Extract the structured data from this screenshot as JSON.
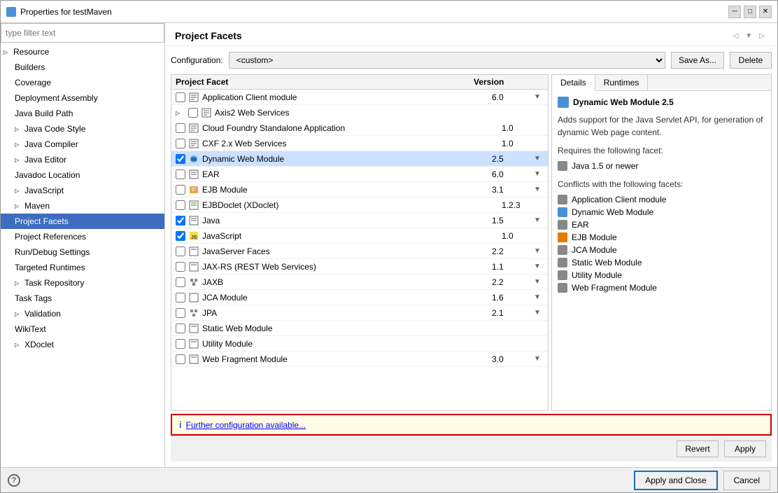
{
  "window": {
    "title": "Properties for testMaven"
  },
  "filter": {
    "placeholder": "type filter text"
  },
  "sidebar": {
    "items": [
      {
        "id": "resource",
        "label": "Resource",
        "expandable": true,
        "indent": 0
      },
      {
        "id": "builders",
        "label": "Builders",
        "expandable": false,
        "indent": 1
      },
      {
        "id": "coverage",
        "label": "Coverage",
        "expandable": false,
        "indent": 1
      },
      {
        "id": "deployment-assembly",
        "label": "Deployment Assembly",
        "expandable": false,
        "indent": 1
      },
      {
        "id": "java-build-path",
        "label": "Java Build Path",
        "expandable": false,
        "indent": 1
      },
      {
        "id": "java-code-style",
        "label": "Java Code Style",
        "expandable": true,
        "indent": 1
      },
      {
        "id": "java-compiler",
        "label": "Java Compiler",
        "expandable": true,
        "indent": 1
      },
      {
        "id": "java-editor",
        "label": "Java Editor",
        "expandable": true,
        "indent": 1
      },
      {
        "id": "javadoc-location",
        "label": "Javadoc Location",
        "expandable": false,
        "indent": 1
      },
      {
        "id": "javascript",
        "label": "JavaScript",
        "expandable": true,
        "indent": 1
      },
      {
        "id": "maven",
        "label": "Maven",
        "expandable": true,
        "indent": 1
      },
      {
        "id": "project-facets",
        "label": "Project Facets",
        "expandable": false,
        "indent": 1,
        "selected": true
      },
      {
        "id": "project-references",
        "label": "Project References",
        "expandable": false,
        "indent": 1
      },
      {
        "id": "run-debug-settings",
        "label": "Run/Debug Settings",
        "expandable": false,
        "indent": 1
      },
      {
        "id": "targeted-runtimes",
        "label": "Targeted Runtimes",
        "expandable": false,
        "indent": 1
      },
      {
        "id": "task-repository",
        "label": "Task Repository",
        "expandable": true,
        "indent": 1
      },
      {
        "id": "task-tags",
        "label": "Task Tags",
        "expandable": false,
        "indent": 1
      },
      {
        "id": "validation",
        "label": "Validation",
        "expandable": true,
        "indent": 1
      },
      {
        "id": "wikitext",
        "label": "WikiText",
        "expandable": false,
        "indent": 1
      },
      {
        "id": "xdoclet",
        "label": "XDoclet",
        "expandable": true,
        "indent": 1
      }
    ]
  },
  "page": {
    "title": "Project Facets",
    "config_label": "Configuration:",
    "config_value": "<custom>",
    "save_as_label": "Save As...",
    "delete_label": "Delete"
  },
  "facets_table": {
    "col_name": "Project Facet",
    "col_version": "Version",
    "rows": [
      {
        "id": "app-client",
        "checked": false,
        "icon": "page",
        "name": "Application Client module",
        "version": "6.0",
        "has_dropdown": true,
        "expandable": false,
        "selected": false
      },
      {
        "id": "axis2",
        "checked": false,
        "icon": "page",
        "name": "Axis2 Web Services",
        "version": "",
        "has_dropdown": false,
        "expandable": true,
        "selected": false
      },
      {
        "id": "cloud-foundry",
        "checked": false,
        "icon": "page",
        "name": "Cloud Foundry Standalone Application",
        "version": "1.0",
        "has_dropdown": false,
        "expandable": false,
        "selected": false
      },
      {
        "id": "cxf",
        "checked": false,
        "icon": "page",
        "name": "CXF 2.x Web Services",
        "version": "1.0",
        "has_dropdown": false,
        "expandable": false,
        "selected": false
      },
      {
        "id": "dynamic-web",
        "checked": true,
        "icon": "module",
        "name": "Dynamic Web Module",
        "version": "2.5",
        "has_dropdown": true,
        "expandable": false,
        "selected": true
      },
      {
        "id": "ear",
        "checked": false,
        "icon": "page",
        "name": "EAR",
        "version": "6.0",
        "has_dropdown": true,
        "expandable": false,
        "selected": false
      },
      {
        "id": "ejb",
        "checked": false,
        "icon": "ejb",
        "name": "EJB Module",
        "version": "3.1",
        "has_dropdown": true,
        "expandable": false,
        "selected": false
      },
      {
        "id": "ejbdoclet",
        "checked": false,
        "icon": "page",
        "name": "EJBDoclet (XDoclet)",
        "version": "1.2.3",
        "has_dropdown": false,
        "expandable": false,
        "selected": false
      },
      {
        "id": "java",
        "checked": true,
        "icon": "page",
        "name": "Java",
        "version": "1.5",
        "has_dropdown": true,
        "expandable": false,
        "selected": false
      },
      {
        "id": "javascript",
        "checked": true,
        "icon": "js",
        "name": "JavaScript",
        "version": "1.0",
        "has_dropdown": false,
        "expandable": false,
        "selected": false
      },
      {
        "id": "jsf",
        "checked": false,
        "icon": "page",
        "name": "JavaServer Faces",
        "version": "2.2",
        "has_dropdown": true,
        "expandable": false,
        "selected": false
      },
      {
        "id": "jax-rs",
        "checked": false,
        "icon": "page",
        "name": "JAX-RS (REST Web Services)",
        "version": "1.1",
        "has_dropdown": true,
        "expandable": false,
        "selected": false
      },
      {
        "id": "jaxb",
        "checked": false,
        "icon": "connector",
        "name": "JAXB",
        "version": "2.2",
        "has_dropdown": true,
        "expandable": false,
        "selected": false
      },
      {
        "id": "jca",
        "checked": false,
        "icon": "page",
        "name": "JCA Module",
        "version": "1.6",
        "has_dropdown": true,
        "expandable": false,
        "selected": false
      },
      {
        "id": "jpa",
        "checked": false,
        "icon": "connector",
        "name": "JPA",
        "version": "2.1",
        "has_dropdown": true,
        "expandable": false,
        "selected": false
      },
      {
        "id": "static-web",
        "checked": false,
        "icon": "page",
        "name": "Static Web Module",
        "version": "",
        "has_dropdown": false,
        "expandable": false,
        "selected": false
      },
      {
        "id": "utility",
        "checked": false,
        "icon": "page",
        "name": "Utility Module",
        "version": "",
        "has_dropdown": false,
        "expandable": false,
        "selected": false
      },
      {
        "id": "web-fragment",
        "checked": false,
        "icon": "page",
        "name": "Web Fragment Module",
        "version": "3.0",
        "has_dropdown": true,
        "expandable": false,
        "selected": false
      }
    ]
  },
  "details": {
    "tab_details": "Details",
    "tab_runtimes": "Runtimes",
    "title": "Dynamic Web Module 2.5",
    "description": "Adds support for the Java Servlet API, for generation of dynamic Web page content.",
    "requires_title": "Requires the following facet:",
    "requires_items": [
      {
        "label": "Java 1.5 or newer"
      }
    ],
    "conflicts_title": "Conflicts with the following facets:",
    "conflicts_items": [
      {
        "label": "Application Client module"
      },
      {
        "label": "Dynamic Web Module"
      },
      {
        "label": "EAR"
      },
      {
        "label": "EJB Module"
      },
      {
        "label": "JCA Module"
      },
      {
        "label": "Static Web Module"
      },
      {
        "label": "Utility Module"
      },
      {
        "label": "Web Fragment Module"
      }
    ]
  },
  "further_config": {
    "text": "Further configuration available..."
  },
  "buttons": {
    "revert": "Revert",
    "apply": "Apply",
    "apply_and_close": "Apply and Close",
    "cancel": "Cancel"
  }
}
